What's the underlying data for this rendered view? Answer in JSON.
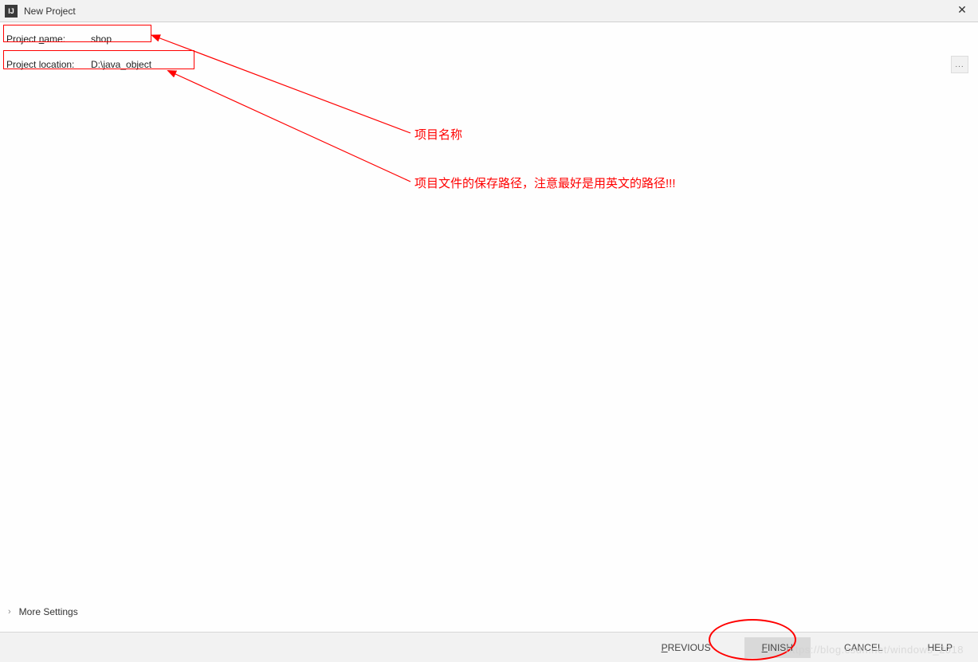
{
  "titlebar": {
    "app_icon_text": "IJ",
    "title": "New Project",
    "close": "✕"
  },
  "fields": {
    "name_label_pre": "Project ",
    "name_label_mn": "n",
    "name_label_post": "ame:",
    "name_value": "shop",
    "loc_label_pre": "Project ",
    "loc_label_mn": "l",
    "loc_label_post": "ocation:",
    "loc_value": "D:\\java_object",
    "browse": "..."
  },
  "annotations": {
    "name": "项目名称",
    "location": "项目文件的保存路径，注意最好是用英文的路径!!!"
  },
  "more_settings": {
    "chevron": "›",
    "label": "More Settings"
  },
  "footer": {
    "previous_mn": "P",
    "previous_rest": "REVIOUS",
    "finish_mn": "F",
    "finish_rest": "INISH",
    "cancel": "CANCEL",
    "help": "HELP"
  },
  "watermark": "https://blog.csdn.net/windows_2018"
}
